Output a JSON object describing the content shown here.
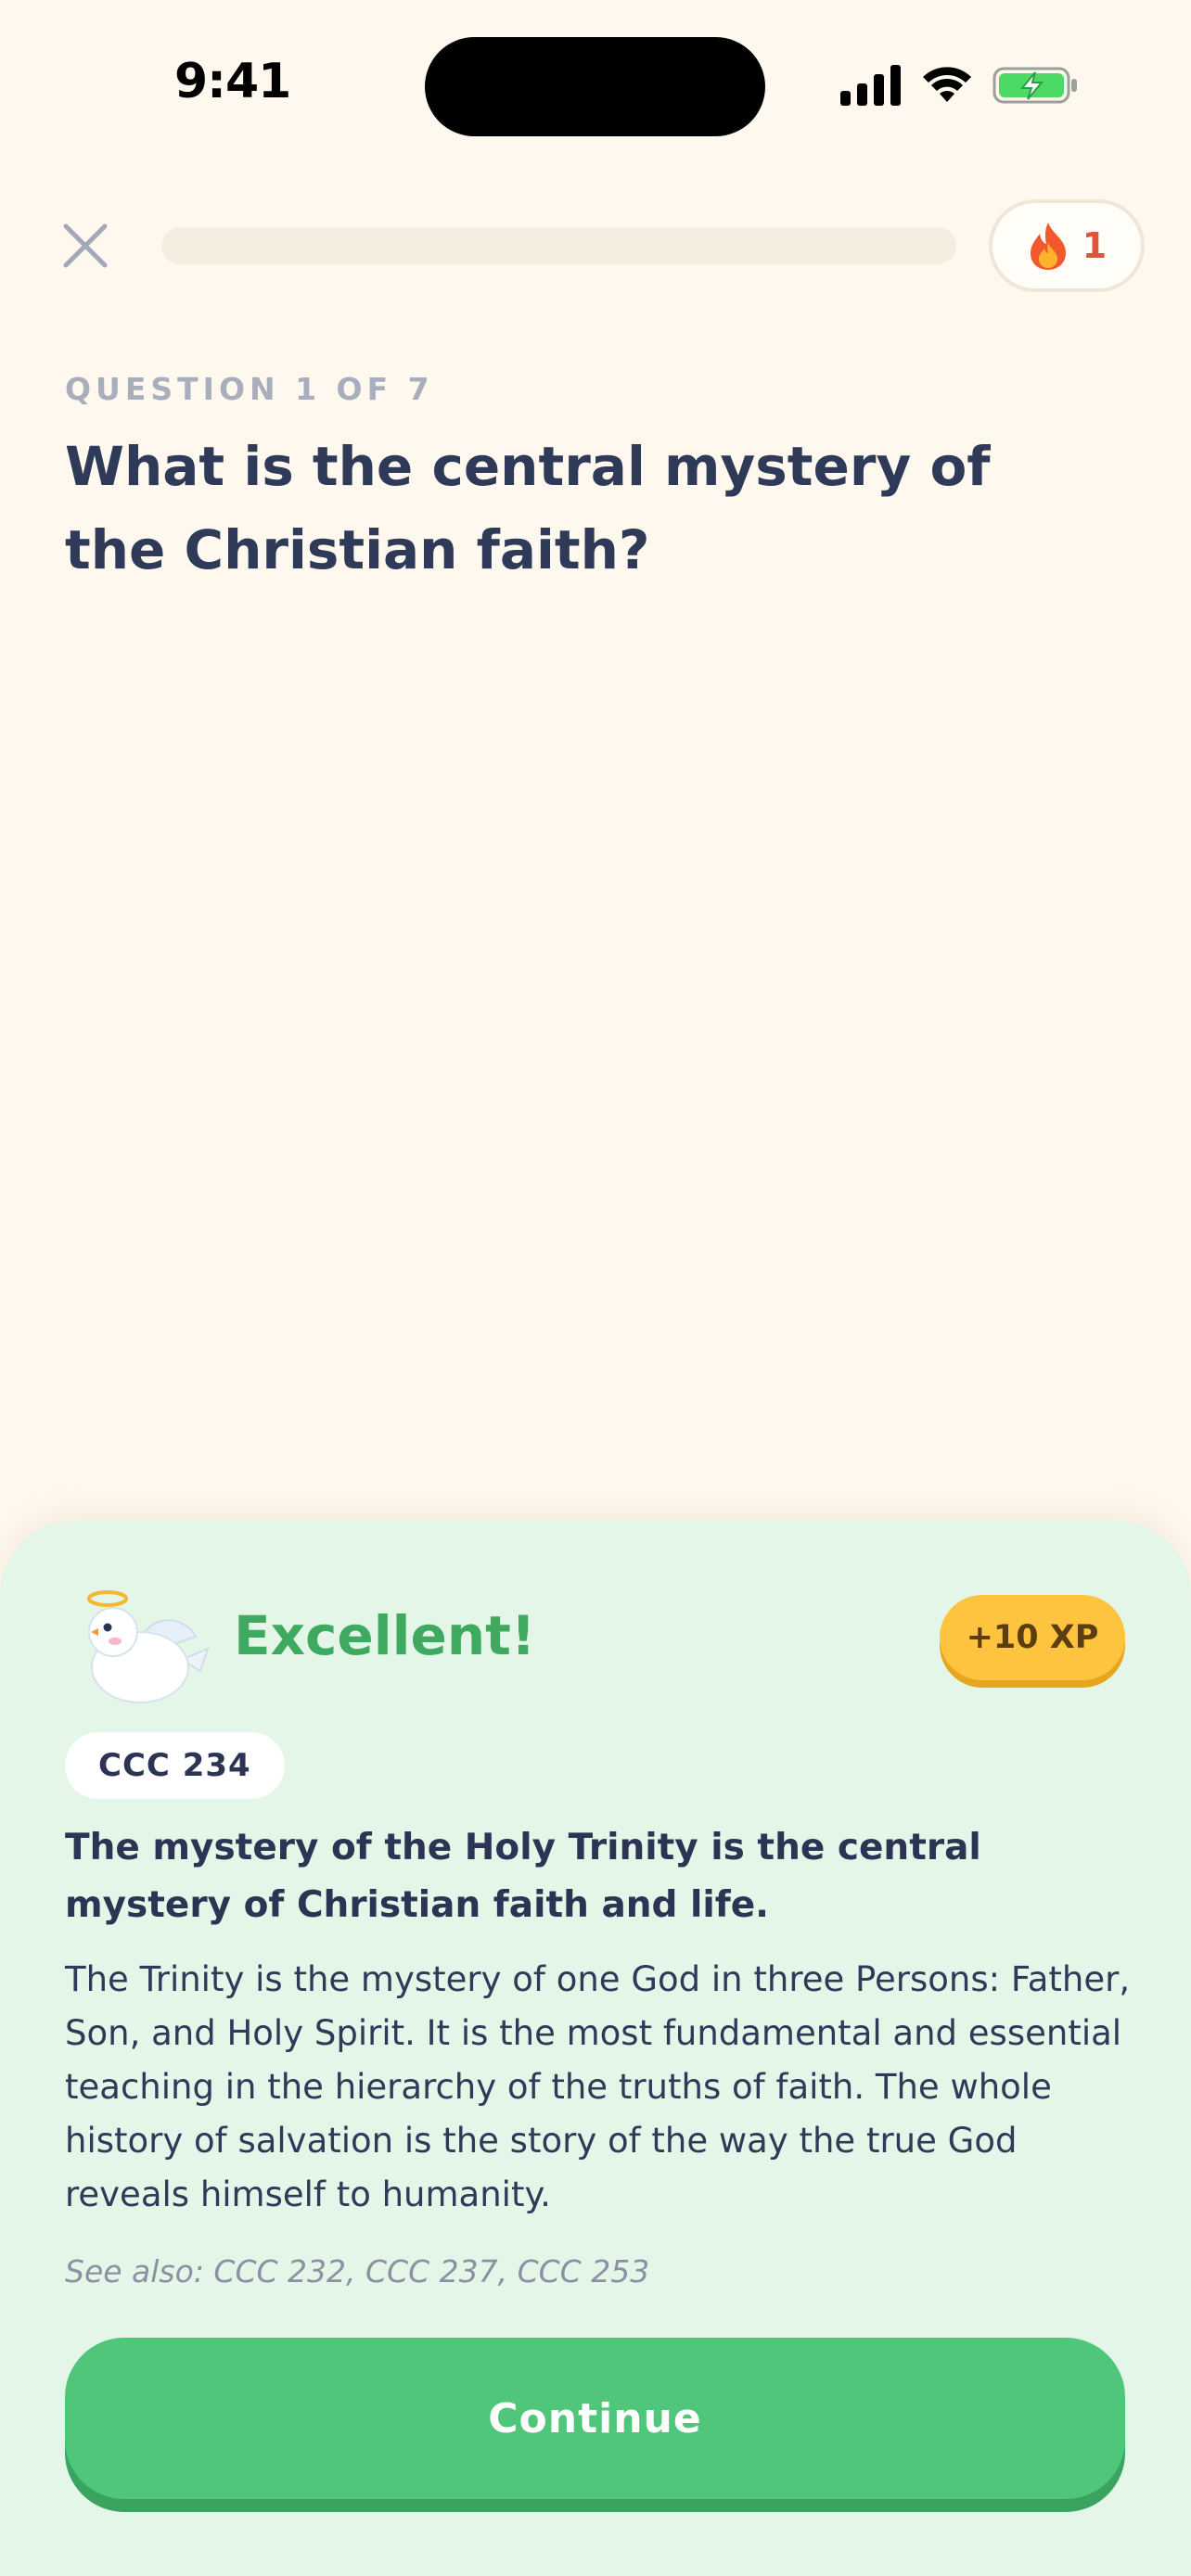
{
  "status_bar": {
    "time": "9:41",
    "icons": [
      "cellular-signal-icon",
      "wifi-icon",
      "battery-charging-icon"
    ]
  },
  "nav": {
    "close_icon": "close-icon",
    "progress_fraction": 0,
    "streak_icon": "flame-icon",
    "streak_count": "1"
  },
  "question": {
    "counter": "QUESTION 1 OF 7",
    "text": "What is the central mystery of the Christian faith?"
  },
  "feedback": {
    "mascot_icon": "angel-dove-mascot",
    "title": "Excellent!",
    "xp": "+10 XP",
    "reference": "CCC 234",
    "summary": "The mystery of the Holy Trinity is the central mystery of Christian faith and life.",
    "explanation": "The Trinity is the mystery of one God in three Persons: Father, Son, and Holy Spirit. It is the most fundamental and essential teaching in the hierarchy of the truths of faith. The whole history of salvation is the story of the way the true God reveals himself to humanity.",
    "see_also": "See also: CCC 232, CCC 237, CCC 253",
    "continue_label": "Continue"
  },
  "colors": {
    "background": "#FFF8EE",
    "sheet_background": "#E3F6E8",
    "accent_green": "#4FC679",
    "title_green": "#3FAA5F",
    "xp_yellow": "#FFC43F",
    "streak_red": "#E0533D",
    "text_dark": "#2B3553"
  }
}
